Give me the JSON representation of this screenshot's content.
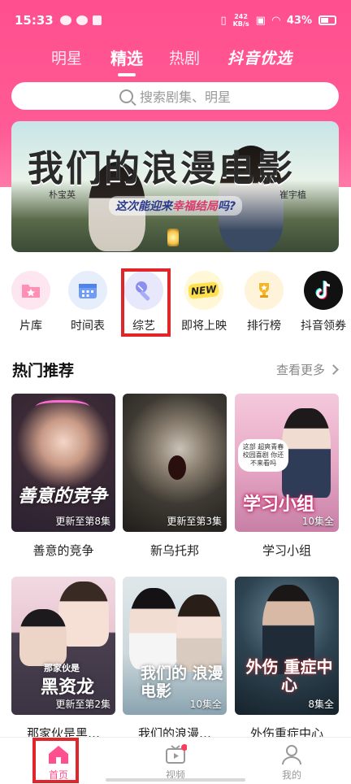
{
  "status_bar": {
    "time": "15:33",
    "speed_top": "242",
    "speed_unit": "KB/s",
    "battery": "43%"
  },
  "top_tabs": [
    {
      "label": "明星"
    },
    {
      "label": "精选"
    },
    {
      "label": "热剧"
    },
    {
      "label": "抖音优选"
    }
  ],
  "search": {
    "placeholder": "搜索剧集、明星"
  },
  "banner": {
    "title": "我们的浪漫电影",
    "subtitle_pre": "这次能迎来",
    "subtitle_highlight": "幸福结局",
    "subtitle_post": "吗?",
    "name_left": "朴宝英",
    "name_right": "崔宇植"
  },
  "shortcuts": [
    {
      "label": "片库",
      "icon": "library-star-icon"
    },
    {
      "label": "时间表",
      "icon": "calendar-icon"
    },
    {
      "label": "综艺",
      "icon": "microphone-icon"
    },
    {
      "label": "即将上映",
      "icon": "new-badge-icon"
    },
    {
      "label": "排行榜",
      "icon": "trophy-icon"
    },
    {
      "label": "抖音领券",
      "icon": "douyin-logo-icon"
    }
  ],
  "section": {
    "title": "热门推荐",
    "more": "查看更多"
  },
  "cards": [
    {
      "title": "善意的竞争",
      "tag": "更新至第8集",
      "poster_text": "善意的竞争"
    },
    {
      "title": "新乌托邦",
      "tag": "更新至第3集",
      "poster_text": ""
    },
    {
      "title": "学习小组",
      "tag": "10集全",
      "poster_text": "学习小组",
      "bubble": "这部 超爽青春校园喜剧 你还不来看吗"
    },
    {
      "title": "那家伙是黑…",
      "tag": "更新至第2集",
      "poster_text": "黑资龙",
      "poster_pre": "那家伙是"
    },
    {
      "title": "我们的浪漫…",
      "tag": "10集全",
      "poster_text": "我们的 浪漫电影"
    },
    {
      "title": "外伤重症中心",
      "tag": "8集全",
      "poster_text": "外伤 重症中心"
    }
  ],
  "bottom_nav": [
    {
      "label": "首页"
    },
    {
      "label": "视频"
    },
    {
      "label": "我的"
    }
  ],
  "colors": {
    "accent": "#ff4f8e",
    "highlight_box": "#e0262b"
  }
}
